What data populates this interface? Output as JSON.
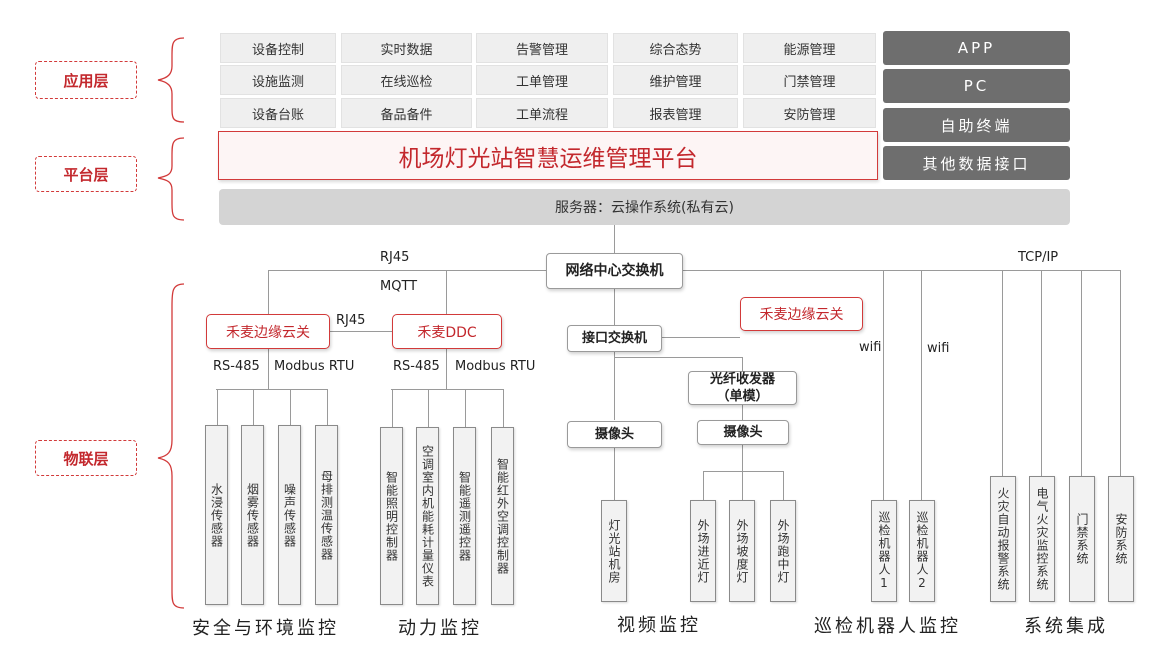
{
  "layers": {
    "application": "应用层",
    "platform": "平台层",
    "iot": "物联层"
  },
  "apps": [
    [
      "设备控制",
      "实时数据",
      "告警管理",
      "综合态势",
      "能源管理"
    ],
    [
      "设施监测",
      "在线巡检",
      "工单管理",
      "维护管理",
      "门禁管理"
    ],
    [
      "设备台账",
      "备品备件",
      "工单流程",
      "报表管理",
      "安防管理"
    ]
  ],
  "terminals": [
    "APP",
    "PC",
    "自助终端",
    "其他数据接口"
  ],
  "platform_title": "机场灯光站智慧运维管理平台",
  "server": "服务器：云操作系统(私有云)",
  "network": {
    "core_switch": "网络中心交换机",
    "rj45_top": "RJ45",
    "mqtt": "MQTT",
    "tcpip": "TCP/IP",
    "rj45_mid": "RJ45",
    "wifi1": "wifi",
    "wifi2": "wifi"
  },
  "gateways": {
    "edge1": "禾麦边缘云关",
    "ddc": "禾麦DDC",
    "edge2": "禾麦边缘云关",
    "iface_switch": "接口交换机",
    "fiber": "光纤收发器\n（单模）",
    "cam1": "摄像头",
    "cam2": "摄像头"
  },
  "protocols": {
    "rs485_a": "RS-485",
    "modbus_a": "Modbus RTU",
    "rs485_b": "RS-485",
    "modbus_b": "Modbus RTU"
  },
  "devices": {
    "env": [
      "水浸传感器",
      "烟雾传感器",
      "噪声传感器",
      "母排测温传感器"
    ],
    "power": [
      "智能照明控制器",
      "空调室内机能耗计量仪表",
      "智能遥测遥控器",
      "智能红外空调控制器"
    ],
    "video": [
      "灯光站机房",
      "外场进近灯",
      "外场坡度灯",
      "外场跑中灯"
    ],
    "robot": [
      "巡检机器人1",
      "巡检机器人2"
    ],
    "integration": [
      "火灾自动报警系统",
      "电气火灾监控系统",
      "门禁系统",
      "安防系统"
    ]
  },
  "categories": [
    "安全与环境监控",
    "动力监控",
    "视频监控",
    "巡检机器人监控",
    "系统集成"
  ]
}
